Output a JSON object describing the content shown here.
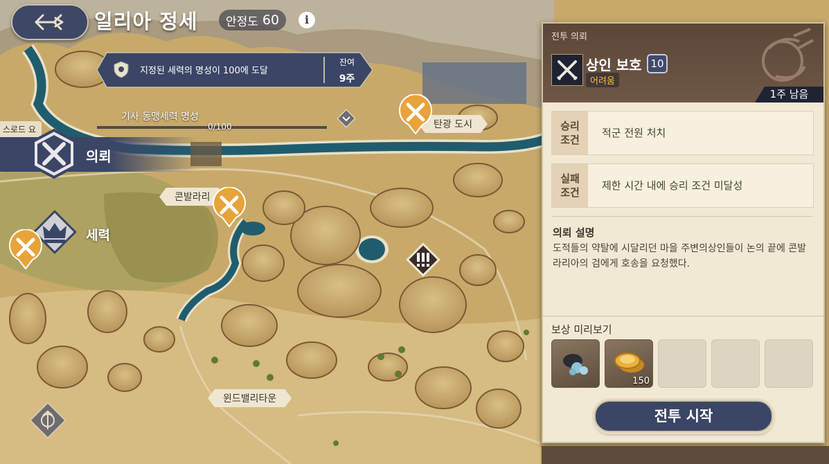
{
  "header": {
    "title": "일리아 정세",
    "stability_label": "안정도",
    "stability_value": "60",
    "info_icon": "i"
  },
  "objective": {
    "text": "지정된 세력의 명성이 100에 도달",
    "remaining_label": "잔여",
    "remaining_value": "9주",
    "reputation_label": "기사 동맹세력 명성",
    "reputation_value": "0/100",
    "reputation_progress": 0
  },
  "left_menu": {
    "sword_label": "스로드 요",
    "quest_label": "의뢰",
    "faction_label": "세력"
  },
  "map": {
    "places": [
      "탄광 도시",
      "콘발라리",
      "윈드밸리타운"
    ]
  },
  "panel": {
    "category": "전투 의뢰",
    "quest_title": "상인 보호",
    "quest_level": "10",
    "difficulty": "어려움",
    "weeks_left": "1주 남음",
    "victory_tag": "승리\n조건",
    "victory_text": "적군 전원 처치",
    "failure_tag": "실패\n조건",
    "failure_text": "제한 시간 내에 승리 조건 미달성",
    "desc_title": "의뢰 설명",
    "desc_text": "도적들의 약탈에 시달리던 마을 주변의상인들이 논의 끝에 콘발라리아의 검에게 호송을 요청했다.",
    "reward_title": "보상 미리보기",
    "rewards": [
      {
        "icon": "ore-icon",
        "count": ""
      },
      {
        "icon": "gold-coins-icon",
        "count": "150"
      },
      {
        "icon": "empty",
        "count": ""
      },
      {
        "icon": "empty",
        "count": ""
      },
      {
        "icon": "empty",
        "count": ""
      }
    ],
    "start_button": "전투 시작"
  },
  "colors": {
    "navy": "#3b4565",
    "marker_orange": "#e8a33a",
    "difficulty_yellow": "#f1c531",
    "panel_bg": "#f1e9d4",
    "river": "#1f5d6e"
  }
}
